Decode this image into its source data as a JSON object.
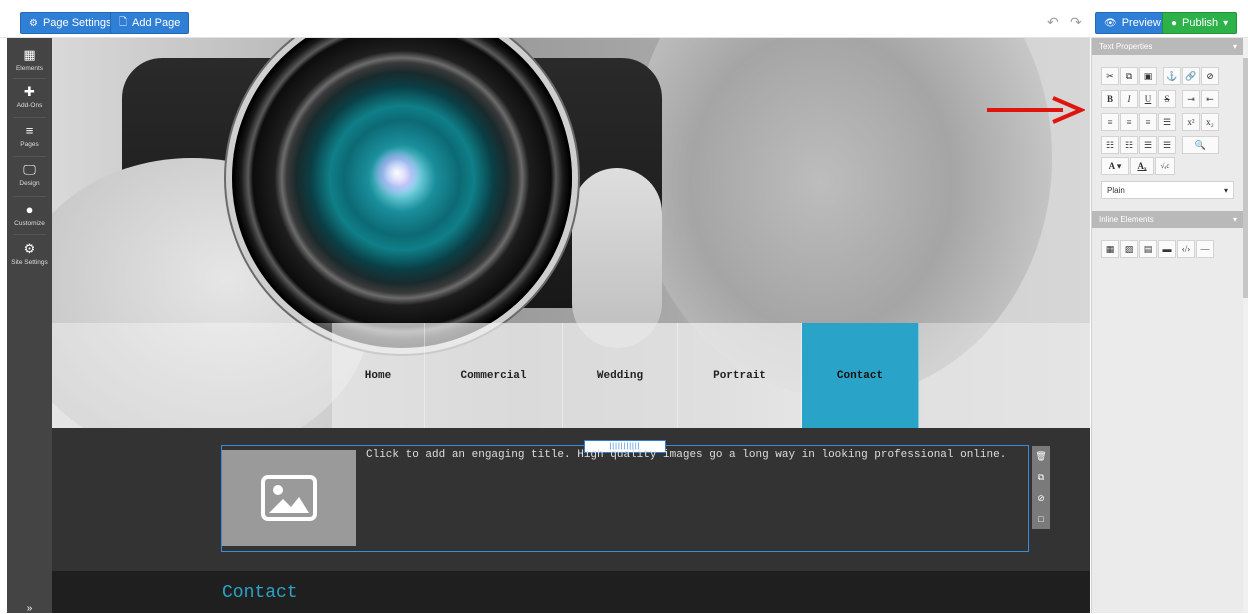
{
  "topbar": {
    "page_settings_label": "Page Settings",
    "add_page_label": "Add Page",
    "preview_label": "Preview",
    "publish_label": "Publish"
  },
  "leftbar": {
    "items": [
      {
        "label": "Elements",
        "icon": "grid-icon"
      },
      {
        "label": "Add-Ons",
        "icon": "plus-icon"
      },
      {
        "label": "Pages",
        "icon": "hamburger-icon"
      },
      {
        "label": "Design",
        "icon": "monitor-icon"
      },
      {
        "label": "Customize",
        "icon": "drop-icon"
      },
      {
        "label": "Site Settings",
        "icon": "gear-icon"
      }
    ]
  },
  "canvas": {
    "nav": [
      "Home",
      "Commercial",
      "Wedding",
      "Portrait",
      "Contact"
    ],
    "active_nav": "Contact",
    "block_text": "Click to add an engaging title. High quality images go a long way in looking professional online.",
    "contact_title": "Contact",
    "accent_color": "#2aa3c8"
  },
  "right_panel": {
    "text_properties_label": "Text Properties",
    "format_select_value": "Plain",
    "inline_elements_label": "Inline Elements"
  },
  "colors": {
    "primary_button": "#2f7fd6",
    "publish_button": "#2db24a",
    "arrow": "#e0140f"
  }
}
